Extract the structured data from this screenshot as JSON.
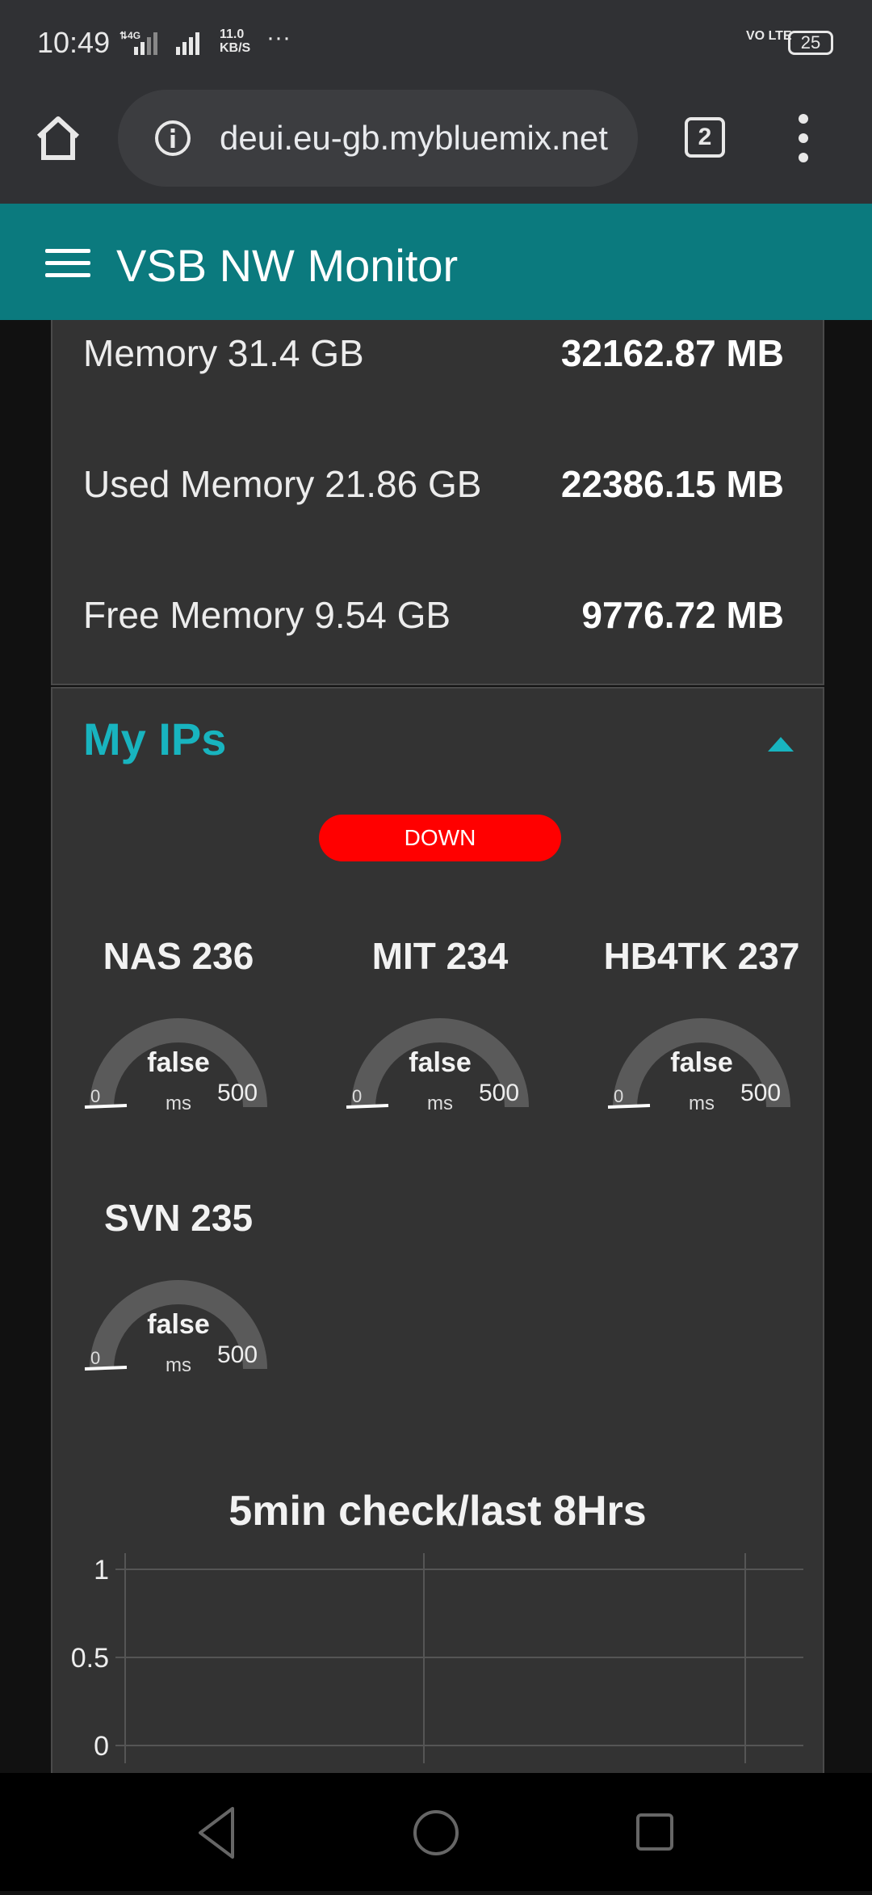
{
  "status_bar": {
    "time": "10:49",
    "network_speed_value": "11.0",
    "network_speed_unit": "KB/S",
    "overflow": "···",
    "volte": "VO LTE",
    "battery": "25"
  },
  "browser": {
    "url": "deui.eu-gb.mybluemix.net",
    "tab_count": "2"
  },
  "app": {
    "title": "VSB NW Monitor"
  },
  "memory": {
    "rows": [
      {
        "label": "Memory 31.4 GB",
        "value": "32162.87 MB"
      },
      {
        "label": "Used Memory 21.86 GB",
        "value": "22386.15 MB"
      },
      {
        "label": "Free Memory 9.54 GB",
        "value": "9776.72 MB"
      }
    ]
  },
  "ips": {
    "title": "My IPs",
    "status": "DOWN",
    "status_color": "#ff0000",
    "accent_color": "#18b4bf",
    "gauges": [
      {
        "name": "NAS 236",
        "value": "false",
        "min": "0",
        "max": "500",
        "units": "ms",
        "level": 0
      },
      {
        "name": "MIT 234",
        "value": "false",
        "min": "0",
        "max": "500",
        "units": "ms",
        "level": 0
      },
      {
        "name": "HB4TK 237",
        "value": "false",
        "min": "0",
        "max": "500",
        "units": "ms",
        "level": 0
      },
      {
        "name": "SVN 235",
        "value": "false",
        "min": "0",
        "max": "500",
        "units": "ms",
        "level": 0
      }
    ]
  },
  "chart_data": {
    "type": "line",
    "title": "5min check/last 8Hrs",
    "yticks": [
      "1",
      "0.5",
      "0"
    ],
    "ylim": [
      0,
      1
    ],
    "grid": true,
    "series": []
  }
}
